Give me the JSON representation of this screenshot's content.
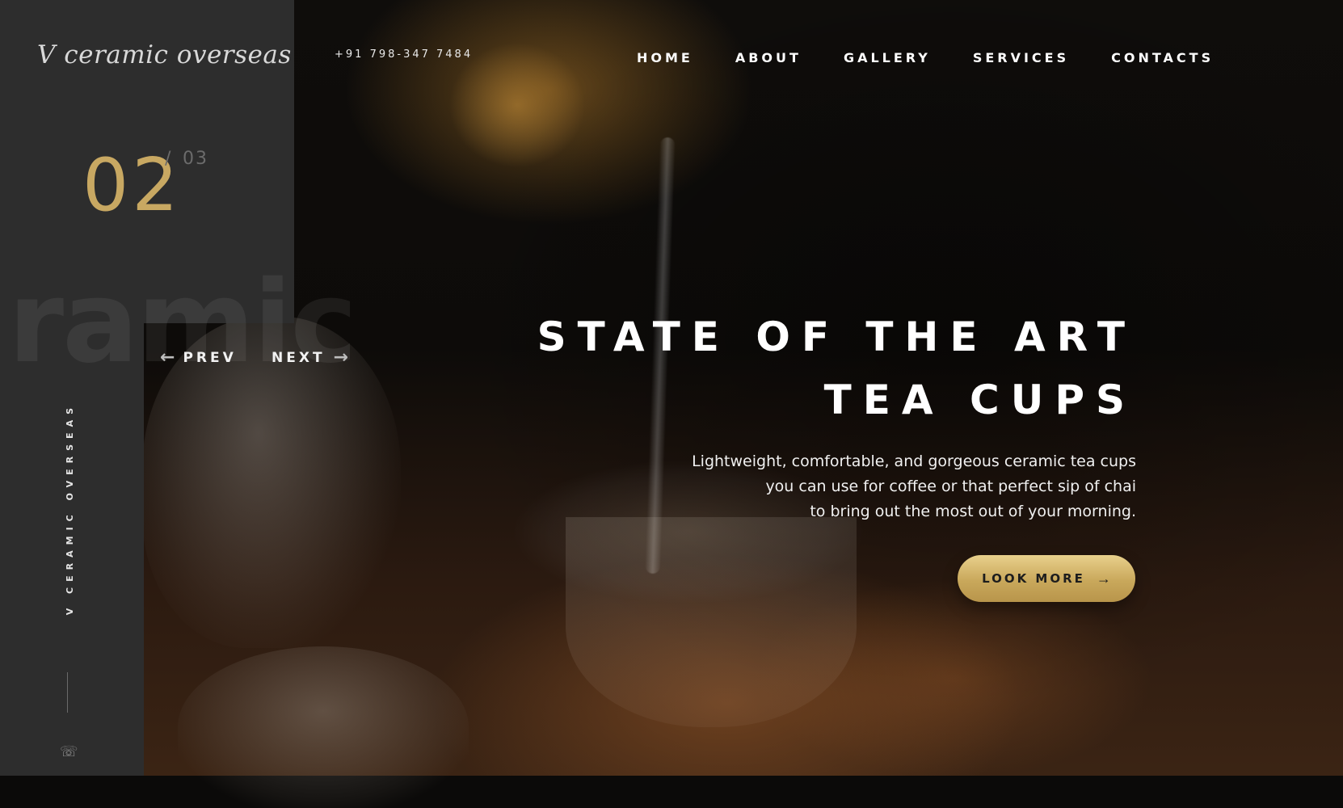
{
  "brand": {
    "logo_text": "V ceramic overseas",
    "vertical_text": "V CERAMIC OVERSEAS",
    "watermark": "ramic"
  },
  "header": {
    "phone": "+91 798-347 7484",
    "nav": [
      "HOME",
      "ABOUT",
      "GALLERY",
      "SERVICES",
      "CONTACTS"
    ]
  },
  "slider": {
    "current": "02",
    "separator": "/",
    "total": "03",
    "prev_label": "PREV",
    "next_label": "NEXT"
  },
  "hero": {
    "title_line1": "STATE OF THE ART",
    "title_line2": "TEA CUPS",
    "description_lines": [
      "Lightweight, comfortable, and gorgeous ceramic tea cups",
      "you can use for coffee or that perfect sip of chai",
      "to bring out the most out of your morning."
    ],
    "cta_label": "LOOK MORE"
  },
  "icons": {
    "prev": "arrow-left-icon",
    "next": "arrow-right-icon",
    "cta": "arrow-right-icon",
    "contact": "whatsapp-icon"
  },
  "colors": {
    "panel": "#2d2d2d",
    "accent_gold": "#c8a862",
    "text": "#ffffff"
  }
}
